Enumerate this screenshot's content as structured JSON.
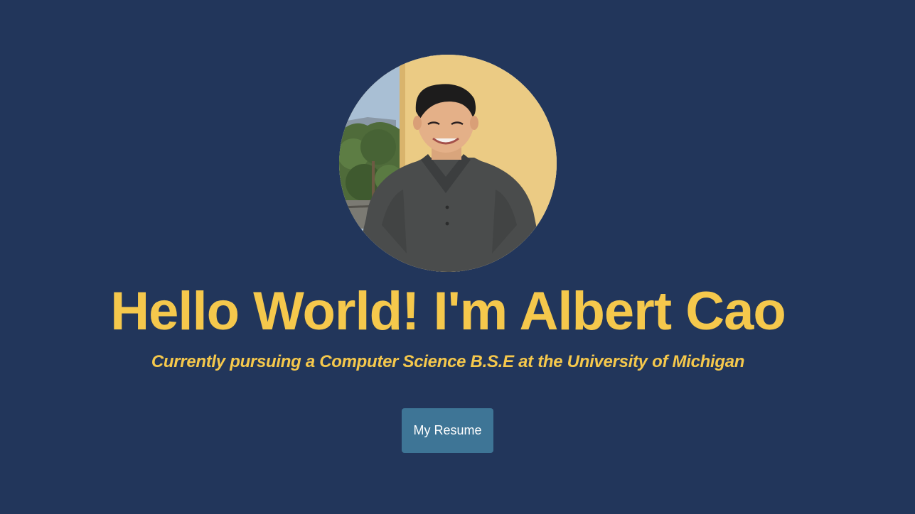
{
  "hero": {
    "title": "Hello World! I'm Albert Cao",
    "subtitle": "Currently pursuing a Computer Science B.S.E at the University of Michigan",
    "resume_button_label": "My Resume",
    "avatar_alt": "profile-photo"
  },
  "colors": {
    "background": "#22365b",
    "accent": "#f5c84c",
    "button": "#3e7596",
    "button_text": "#ffffff"
  }
}
